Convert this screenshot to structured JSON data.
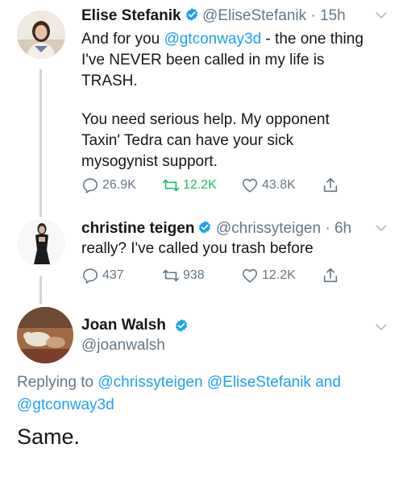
{
  "tweets": [
    {
      "name": "Elise Stefanik",
      "handle": "@EliseStefanik",
      "time": "15h",
      "text_pre": "And for you ",
      "mention": "@gtconway3d",
      "text_post": " - the one thing I've NEVER been called in my life is TRASH.",
      "text_p2": "You need serious help. My opponent Taxin' Tedra can have your sick mysogynist support.",
      "replies": "26.9K",
      "retweets": "12.2K",
      "likes": "43.8K"
    },
    {
      "name": "christine teigen",
      "handle": "@chrissyteigen",
      "time": "6h",
      "text": "really? I've called you trash before",
      "replies": "437",
      "retweets": "938",
      "likes": "12.2K"
    }
  ],
  "main_tweet": {
    "name": "Joan Walsh",
    "handle": "@joanwalsh",
    "replying_prefix": "Replying to ",
    "reply_mention_1": "@chrissyteigen",
    "reply_mention_2": "@EliseStefanik",
    "reply_and": " and",
    "reply_mention_3": "@gtconway3d",
    "text": "Same."
  },
  "icons": {
    "verified": "verified-badge-icon",
    "reply": "reply-icon",
    "retweet": "retweet-icon",
    "like": "heart-icon",
    "share": "share-icon",
    "chevron": "chevron-down-icon"
  },
  "colors": {
    "link": "#1da1f2",
    "muted": "#657786",
    "retweet_active": "#17bf63",
    "verified": "#1da1f2"
  }
}
